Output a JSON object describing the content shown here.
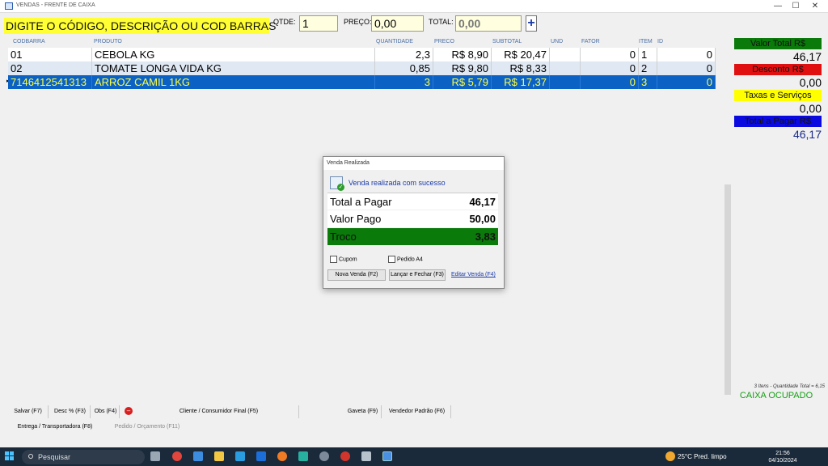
{
  "window": {
    "title": "VENDAS - FRENTE DE CAIXA",
    "min": "—",
    "max": "☐",
    "close": "✕"
  },
  "header": {
    "instruction": "DIGITE O  CÓDIGO, DESCRIÇÃO OU COD BARRAS",
    "qtde_label": "QTDE:",
    "qtde_value": "1",
    "preco_label": "PREÇO:",
    "preco_value": "0,00",
    "total_label": "TOTAL:",
    "total_value": "0,00",
    "add_label": "+"
  },
  "grid": {
    "columns": [
      "CODBARRA",
      "PRODUTO",
      "QUANTIDADE",
      "PRECO",
      "SUBTOTAL",
      "UND",
      "FATOR",
      "ITEM",
      "ID"
    ],
    "rows": [
      {
        "codbarra": "01",
        "produto": "CEBOLA KG",
        "quantidade": "2,3",
        "preco": "R$ 8,90",
        "subtotal": "R$ 20,47",
        "und": "",
        "fator": "0",
        "item": "1",
        "id": "0"
      },
      {
        "codbarra": "02",
        "produto": "TOMATE LONGA VIDA KG",
        "quantidade": "0,85",
        "preco": "R$ 9,80",
        "subtotal": "R$ 8,33",
        "und": "",
        "fator": "0",
        "item": "2",
        "id": "0"
      },
      {
        "codbarra": "7146412541313",
        "produto": "ARROZ CAMIL 1KG",
        "quantidade": "3",
        "preco": "R$ 5,79",
        "subtotal": "R$ 17,37",
        "und": "",
        "fator": "0",
        "item": "3",
        "id": "0",
        "selected": true
      }
    ]
  },
  "summary": {
    "valor_total_label": "Valor Total R$",
    "valor_total": "46,17",
    "desconto_label": "Desconto R$",
    "desconto": "0,00",
    "taxas_label": "Taxas e Serviços",
    "taxas": "0,00",
    "total_pagar_label": "Total a Pagar R$",
    "total_pagar": "46,17",
    "items_info": "3 Itens - Quantidade Total = 6,15",
    "caixa_status": "CAIXA OCUPADO"
  },
  "dialog": {
    "title": "Venda Realizada",
    "message": "Venda realizada com sucesso",
    "total_pagar_label": "Total a Pagar",
    "total_pagar": "46,17",
    "valor_pago_label": "Valor Pago",
    "valor_pago": "50,00",
    "troco_label": "Troco",
    "troco": "3,83",
    "cupom_label": "Cupom",
    "pedido_label": "Pedido A4",
    "nova_venda": "Nova Venda (F2)",
    "lancar_fechar": "Lançar e Fechar (F3)",
    "editar_venda": "Editar Venda (F4)"
  },
  "footer": {
    "salvar": "Salvar (F7)",
    "desc": "Desc % (F3)",
    "obs": "Obs (F4)",
    "cliente": "Cliente / Consumidor Final (F5)",
    "gaveta": "Gaveta (F9)",
    "vendedor": "Vendedor Padrão (F6)",
    "entrega": "Entrega / Transportadora (F8)",
    "pedido": "Pedido / Orçamento (F11)"
  },
  "taskbar": {
    "search_placeholder": "Pesquisar",
    "weather": "25°C  Pred. limpo",
    "time": "21:56",
    "date": "04/10/2024"
  },
  "colors": {
    "instruction_bg": "#ffff33",
    "selected_row": "#0b62c4",
    "valor_total_bg": "#0a7a0a",
    "desconto_bg": "#e01010",
    "taxas_bg": "#ffff00",
    "total_pagar_bg": "#0a0ae0",
    "troco_bg": "#0a7a0a"
  }
}
